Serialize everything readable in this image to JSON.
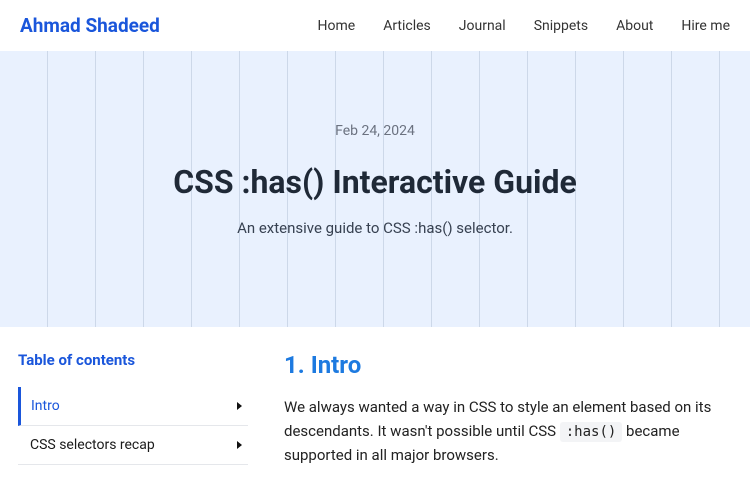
{
  "header": {
    "logo": "Ahmad Shadeed",
    "nav": [
      "Home",
      "Articles",
      "Journal",
      "Snippets",
      "About",
      "Hire me"
    ]
  },
  "hero": {
    "date": "Feb 24, 2024",
    "title": "CSS :has() Interactive Guide",
    "subtitle": "An extensive guide to CSS :has() selector."
  },
  "toc": {
    "title": "Table of contents",
    "items": [
      {
        "label": "Intro",
        "active": true
      },
      {
        "label": "CSS selectors recap",
        "active": false
      }
    ]
  },
  "article": {
    "heading": "1. Intro",
    "body_before": "We always wanted a way in CSS to style an element based on its descendants. It wasn't possible until CSS ",
    "code": ":has()",
    "body_after": " became supported in all major browsers."
  }
}
